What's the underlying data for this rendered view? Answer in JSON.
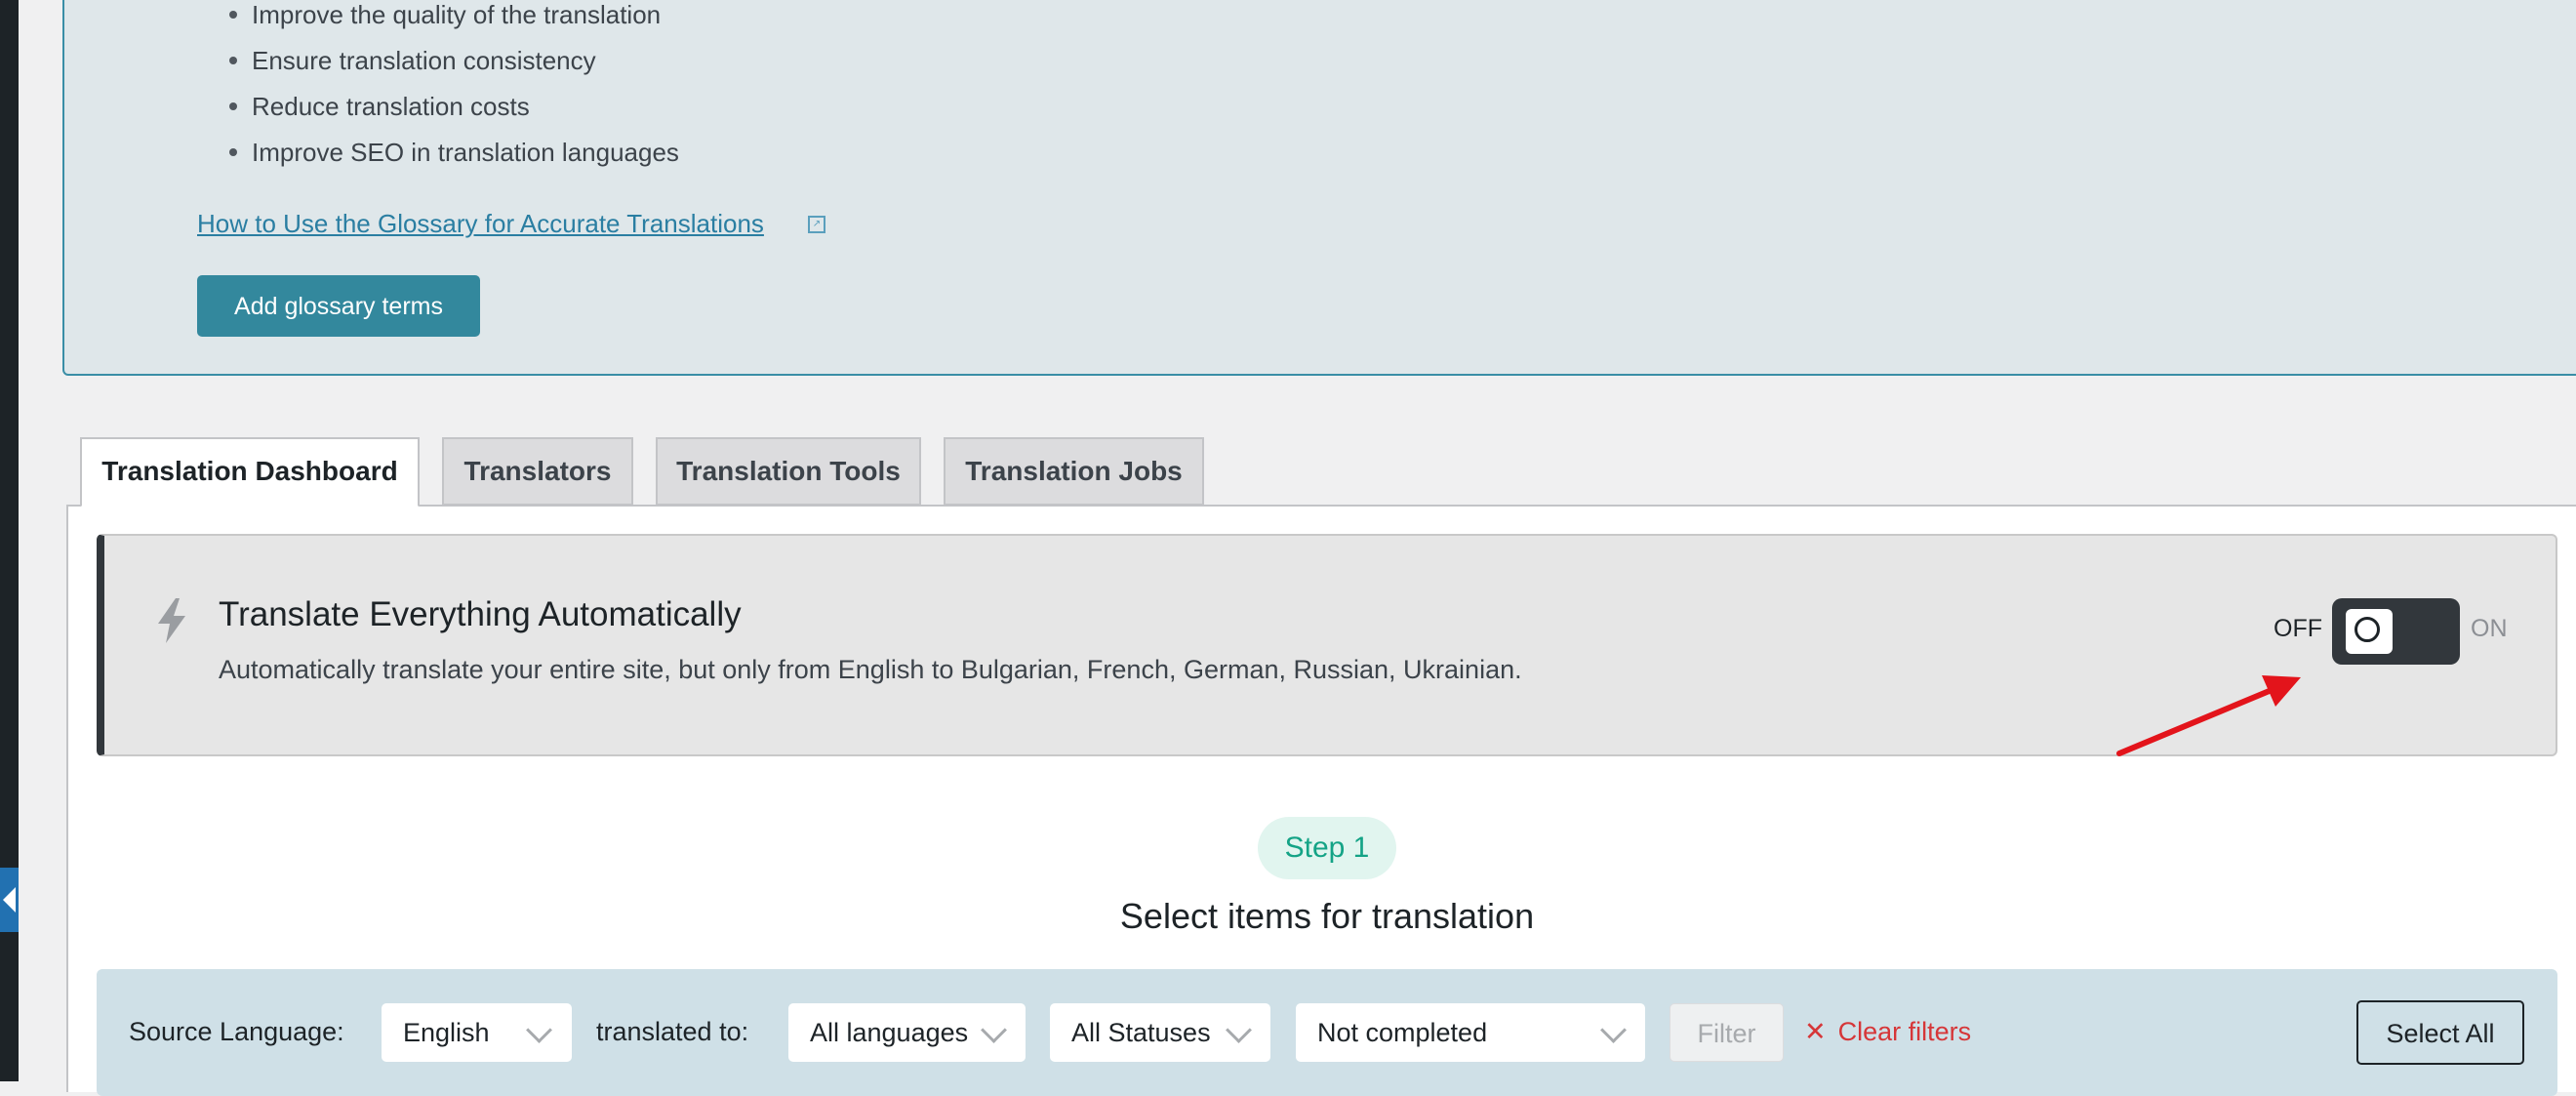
{
  "glossary": {
    "bullets": [
      "Improve the quality of the translation",
      "Ensure translation consistency",
      "Reduce translation costs",
      "Improve SEO in translation languages"
    ],
    "help_link": "How to Use the Glossary for Accurate Translations",
    "add_button": "Add glossary terms"
  },
  "tabs": [
    {
      "label": "Translation Dashboard",
      "active": true
    },
    {
      "label": "Translators",
      "active": false
    },
    {
      "label": "Translation Tools",
      "active": false
    },
    {
      "label": "Translation Jobs",
      "active": false
    }
  ],
  "translate_everything": {
    "icon": "lightning-bolt-icon",
    "title": "Translate Everything Automatically",
    "description": "Automatically translate your entire site, but only from English to Bulgarian, French, German, Russian, Ukrainian.",
    "off_label": "OFF",
    "on_label": "ON",
    "enabled": false
  },
  "step": {
    "badge": "Step 1",
    "title": "Select items for translation"
  },
  "filters": {
    "source_language_label": "Source Language:",
    "source_language_value": "English",
    "translated_to_label": "translated to:",
    "target_language_value": "All languages",
    "status_value": "All Statuses",
    "completion_value": "Not completed",
    "filter_button": "Filter",
    "clear_filters": "Clear filters",
    "select_all": "Select All"
  },
  "colors": {
    "accent": "#33889d",
    "link": "#2a7ea2",
    "danger": "#d63638",
    "step": "#14a386",
    "annotation": "#e3141b"
  }
}
